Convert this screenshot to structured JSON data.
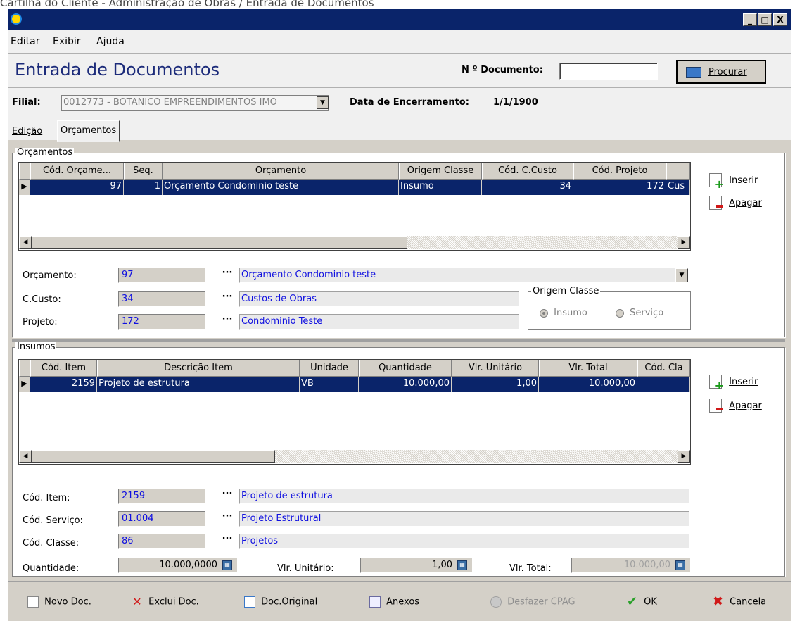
{
  "caption": "Cartilha do Cliente - Administração de Obras / Entrada de Documentos",
  "window_buttons": {
    "min": "_",
    "max": "□",
    "close": "X"
  },
  "menu": [
    "Editar",
    "Exibir",
    "Ajuda"
  ],
  "header": {
    "title": "Entrada de Documentos",
    "doc_label": "N º Documento:",
    "doc_value": "",
    "search_button": "Procurar"
  },
  "filial": {
    "label": "Filial:",
    "value": "0012773 - BOTANICO EMPREENDIMENTOS IMO",
    "closing_label": "Data de Encerramento:",
    "closing_value": "1/1/1900"
  },
  "tabs": [
    "Edição",
    "Orçamentos"
  ],
  "orcamentos": {
    "group_label": "Orçamentos",
    "columns": [
      "Cód. Orçame...",
      "Seq.",
      "Orçamento",
      "Origem Classe",
      "Cód. C.Custo",
      "Cód. Projeto"
    ],
    "row": {
      "cod": "97",
      "seq": "1",
      "orcamento": "Orçamento Condominio teste",
      "origem": "Insumo",
      "ccusto": "34",
      "projeto": "172",
      "extra": "Cus"
    },
    "insert_button": "Inserir",
    "delete_button": "Apagar",
    "fields": {
      "orcamento_label": "Orçamento:",
      "orcamento_code": "97",
      "orcamento_desc": "Orçamento Condominio teste",
      "ccusto_label": "C.Custo:",
      "ccusto_code": "34",
      "ccusto_desc": "Custos de Obras",
      "projeto_label": "Projeto:",
      "projeto_code": "172",
      "projeto_desc": "Condominio Teste"
    },
    "origem_group": {
      "label": "Origem Classe",
      "option1": "Insumo",
      "option2": "Serviço",
      "selected": "Insumo"
    }
  },
  "insumos": {
    "group_label": "Insumos",
    "columns": [
      "Cód. Item",
      "Descrição Item",
      "Unidade",
      "Quantidade",
      "Vlr. Unitário",
      "Vlr. Total",
      "Cód. Cla"
    ],
    "row": {
      "cod": "2159",
      "descricao": "Projeto de estrutura",
      "unidade": "VB",
      "quantidade": "10.000,00",
      "unitario": "1,00",
      "total": "10.000,00",
      "classe": ""
    },
    "insert_button": "Inserir",
    "delete_button": "Apagar",
    "fields": {
      "item_label": "Cód. Item:",
      "item_code": "2159",
      "item_desc": "Projeto de estrutura",
      "servico_label": "Cód. Serviço:",
      "servico_code": "01.004",
      "servico_desc": "Projeto Estrutural",
      "classe_label": "Cód. Classe:",
      "classe_code": "86",
      "classe_desc": "Projetos",
      "quantidade_label": "Quantidade:",
      "quantidade_value": "10.000,0000",
      "unitario_label": "Vlr. Unitário:",
      "unitario_value": "1,00",
      "total_label": "Vlr. Total:",
      "total_value": "10.000,00"
    }
  },
  "bottom": {
    "novo": "Novo Doc.",
    "exclui": "Exclui Doc.",
    "original": "Doc.Original",
    "anexos": "Anexos",
    "desfazer": "Desfazer CPAG",
    "ok": "OK",
    "cancela": "Cancela"
  },
  "colors": {
    "titlebar": "#0a246a",
    "selection": "#0a246a",
    "link_blue": "#1010e0",
    "window_bg": "#d4d0c8"
  }
}
